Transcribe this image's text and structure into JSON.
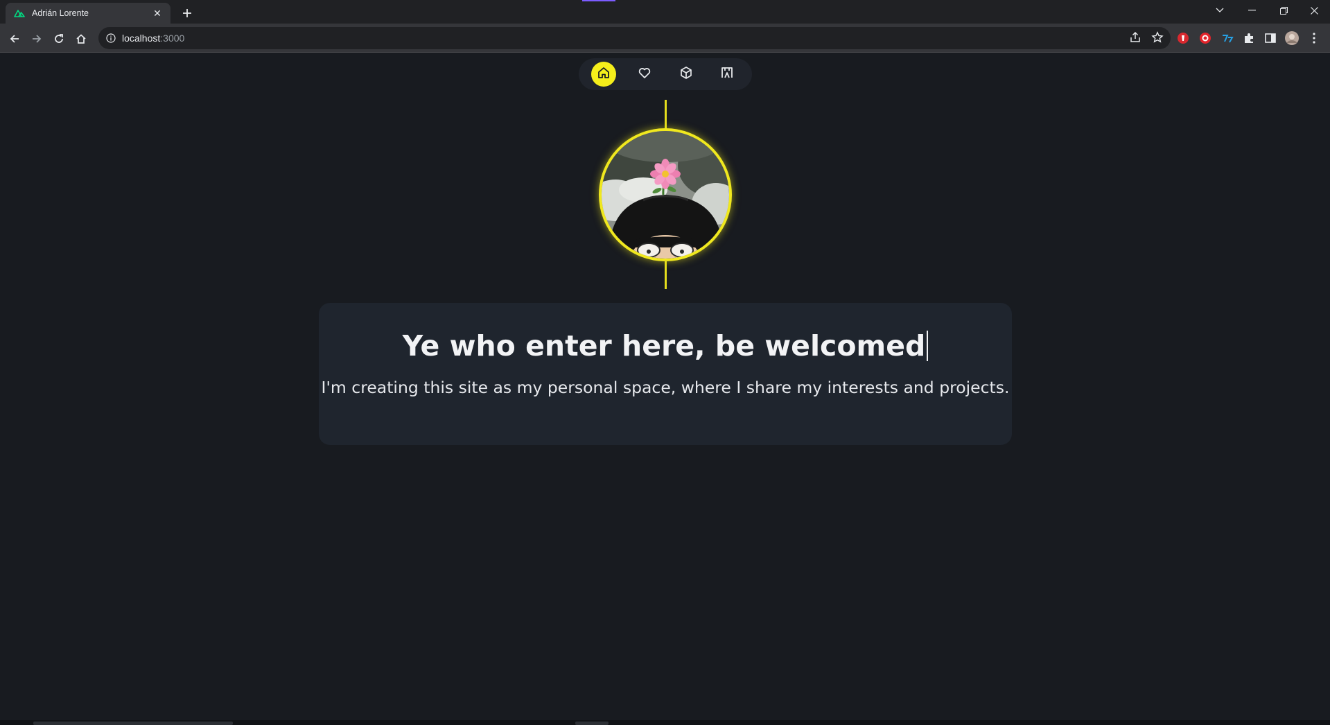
{
  "browser": {
    "tab": {
      "title": "Adrián Lorente",
      "favicon": "nuxt-logo-icon"
    },
    "url": {
      "host": "localhost",
      "port": ":3000"
    },
    "new_tab_label": "+",
    "close_tab_label": "✕"
  },
  "nav": {
    "items": [
      {
        "name": "home",
        "icon": "home-icon",
        "active": true
      },
      {
        "name": "interests",
        "icon": "heart-icon",
        "active": false
      },
      {
        "name": "projects",
        "icon": "cube-icon",
        "active": false
      },
      {
        "name": "gallery",
        "icon": "frame-icon",
        "active": false
      }
    ]
  },
  "avatar": {
    "description_icon": "avatar-flower-head"
  },
  "hero": {
    "title": "Ye who enter here, be welcomed",
    "subtitle": "I'm creating this site as my personal space, where I share my interests and projects."
  },
  "colors": {
    "accent": "#f5ee1b",
    "page_bg": "#181b20",
    "card_bg": "#1f252e",
    "nav_bg": "#20242c"
  }
}
